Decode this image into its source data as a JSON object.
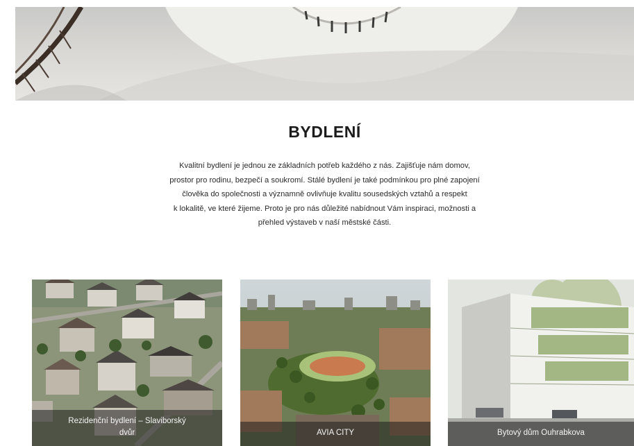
{
  "section": {
    "title": "BYDLENÍ",
    "intro_lines": [
      "Kvalitní bydlení je jednou ze základních potřeb každého z nás. Zajišťuje nám domov,",
      "prostor pro rodinu, bezpečí a soukromí. Stálé bydlení je také podmínkou pro plné zapojení",
      "člověka do společnosti a významně ovlivňuje kvalitu sousedských vztahů a respekt",
      "k lokalitě, ve které žijeme. Proto je pro nás důležité nabídnout Vám inspiraci, možnosti a",
      "přehled výstaveb v naší městské části."
    ]
  },
  "cards": [
    {
      "caption_line1": "Rezidenční bydlení – Slaviborský",
      "caption_line2": "dvůr"
    },
    {
      "caption_line1": "AVIA CITY",
      "caption_line2": ""
    },
    {
      "caption_line1": "Bytový dům Ouhrabkova",
      "caption_line2": ""
    }
  ],
  "colors": {
    "caption_overlay": "#1e1e1e",
    "title": "#1b1b1b",
    "text": "#2a2a2a"
  }
}
